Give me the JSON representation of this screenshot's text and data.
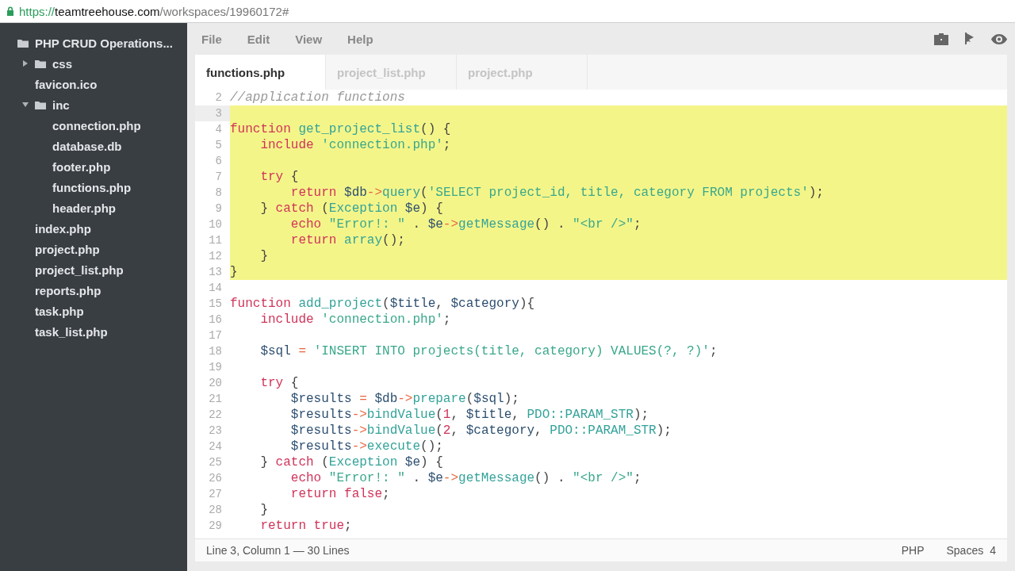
{
  "address_bar": {
    "scheme": "https://",
    "host": "teamtreehouse.com",
    "path": "/workspaces/19960172#"
  },
  "sidebar": {
    "items": [
      {
        "label": "PHP CRUD Operations...",
        "kind": "project",
        "children": [
          {
            "label": "css",
            "kind": "folder",
            "expanded": false
          },
          {
            "label": "favicon.ico",
            "kind": "file"
          },
          {
            "label": "inc",
            "kind": "folder",
            "expanded": true,
            "children": [
              {
                "label": "connection.php",
                "kind": "file"
              },
              {
                "label": "database.db",
                "kind": "file"
              },
              {
                "label": "footer.php",
                "kind": "file"
              },
              {
                "label": "functions.php",
                "kind": "file"
              },
              {
                "label": "header.php",
                "kind": "file"
              }
            ]
          },
          {
            "label": "index.php",
            "kind": "file"
          },
          {
            "label": "project.php",
            "kind": "file"
          },
          {
            "label": "project_list.php",
            "kind": "file"
          },
          {
            "label": "reports.php",
            "kind": "file"
          },
          {
            "label": "task.php",
            "kind": "file"
          },
          {
            "label": "task_list.php",
            "kind": "file"
          }
        ]
      }
    ]
  },
  "menu": [
    "File",
    "Edit",
    "View",
    "Help"
  ],
  "tabs": [
    {
      "label": "functions.php",
      "selected": true
    },
    {
      "label": "project_list.php",
      "selected": false
    },
    {
      "label": "project.php",
      "selected": false
    }
  ],
  "code": [
    {
      "n": "2",
      "highlighted": false,
      "active": false,
      "tokens": [
        {
          "kind": "cmt",
          "text": "//application functions"
        }
      ]
    },
    {
      "n": "3",
      "highlighted": true,
      "active": true
    },
    {
      "n": "4",
      "highlighted": true,
      "active": false,
      "tokens": [
        {
          "kind": "kw",
          "text": "function "
        },
        {
          "kind": "fn",
          "text": "get_project_list"
        },
        {
          "kind": "pl",
          "text": "() {"
        }
      ]
    },
    {
      "n": "5",
      "highlighted": true,
      "active": false,
      "tokens": [
        {
          "kind": "kw",
          "text": "    include "
        },
        {
          "kind": "str",
          "text": "'connection.php'"
        },
        {
          "kind": "pl",
          "text": ";"
        }
      ]
    },
    {
      "n": "6",
      "highlighted": true,
      "active": false
    },
    {
      "n": "7",
      "highlighted": true,
      "active": false,
      "tokens": [
        {
          "kind": "kw",
          "text": "    try"
        },
        {
          "kind": "pl",
          "text": " {"
        }
      ]
    },
    {
      "n": "8",
      "highlighted": true,
      "active": false,
      "tokens": [
        {
          "kind": "kw",
          "text": "        return "
        },
        {
          "kind": "var",
          "text": "$db"
        },
        {
          "kind": "op",
          "text": "->"
        },
        {
          "kind": "fn",
          "text": "query"
        },
        {
          "kind": "pl",
          "text": "("
        },
        {
          "kind": "str",
          "text": "'SELECT project_id, title, category FROM projects'"
        },
        {
          "kind": "pl",
          "text": ");"
        }
      ]
    },
    {
      "n": "9",
      "highlighted": true,
      "active": false,
      "tokens": [
        {
          "kind": "pl",
          "text": "    } "
        },
        {
          "kind": "kw",
          "text": "catch"
        },
        {
          "kind": "pl",
          "text": " ("
        },
        {
          "kind": "cls",
          "text": "Exception"
        },
        {
          "kind": "var",
          "text": " $e"
        },
        {
          "kind": "pl",
          "text": ") {"
        }
      ]
    },
    {
      "n": "10",
      "highlighted": true,
      "active": false,
      "tokens": [
        {
          "kind": "kw",
          "text": "        echo "
        },
        {
          "kind": "str",
          "text": "\"Error!: \""
        },
        {
          "kind": "pl",
          "text": " . "
        },
        {
          "kind": "var",
          "text": "$e"
        },
        {
          "kind": "op",
          "text": "->"
        },
        {
          "kind": "fn",
          "text": "getMessage"
        },
        {
          "kind": "pl",
          "text": "() . "
        },
        {
          "kind": "str",
          "text": "\"<br />\""
        },
        {
          "kind": "pl",
          "text": ";"
        }
      ]
    },
    {
      "n": "11",
      "highlighted": true,
      "active": false,
      "tokens": [
        {
          "kind": "kw",
          "text": "        return "
        },
        {
          "kind": "fn",
          "text": "array"
        },
        {
          "kind": "pl",
          "text": "();"
        }
      ]
    },
    {
      "n": "12",
      "highlighted": true,
      "active": false,
      "tokens": [
        {
          "kind": "pl",
          "text": "    }"
        }
      ]
    },
    {
      "n": "13",
      "highlighted": true,
      "active": false,
      "tokens": [
        {
          "kind": "pl",
          "text": "}"
        }
      ]
    },
    {
      "n": "14",
      "highlighted": false,
      "active": false
    },
    {
      "n": "15",
      "highlighted": false,
      "active": false,
      "tokens": [
        {
          "kind": "kw",
          "text": "function "
        },
        {
          "kind": "fn",
          "text": "add_project"
        },
        {
          "kind": "pl",
          "text": "("
        },
        {
          "kind": "var",
          "text": "$title"
        },
        {
          "kind": "pl",
          "text": ", "
        },
        {
          "kind": "var",
          "text": "$category"
        },
        {
          "kind": "pl",
          "text": "){"
        }
      ]
    },
    {
      "n": "16",
      "highlighted": false,
      "active": false,
      "tokens": [
        {
          "kind": "kw",
          "text": "    include "
        },
        {
          "kind": "str",
          "text": "'connection.php'"
        },
        {
          "kind": "pl",
          "text": ";"
        }
      ]
    },
    {
      "n": "17",
      "highlighted": false,
      "active": false
    },
    {
      "n": "18",
      "highlighted": false,
      "active": false,
      "tokens": [
        {
          "kind": "var",
          "text": "    $sql "
        },
        {
          "kind": "op",
          "text": "= "
        },
        {
          "kind": "str",
          "text": "'INSERT INTO projects(title, category) VALUES(?, ?)'"
        },
        {
          "kind": "pl",
          "text": ";"
        }
      ]
    },
    {
      "n": "19",
      "highlighted": false,
      "active": false
    },
    {
      "n": "20",
      "highlighted": false,
      "active": false,
      "tokens": [
        {
          "kind": "kw",
          "text": "    try"
        },
        {
          "kind": "pl",
          "text": " {"
        }
      ]
    },
    {
      "n": "21",
      "highlighted": false,
      "active": false,
      "tokens": [
        {
          "kind": "var",
          "text": "        $results "
        },
        {
          "kind": "op",
          "text": "= "
        },
        {
          "kind": "var",
          "text": "$db"
        },
        {
          "kind": "op",
          "text": "->"
        },
        {
          "kind": "fn",
          "text": "prepare"
        },
        {
          "kind": "pl",
          "text": "("
        },
        {
          "kind": "var",
          "text": "$sql"
        },
        {
          "kind": "pl",
          "text": ");"
        }
      ]
    },
    {
      "n": "22",
      "highlighted": false,
      "active": false,
      "tokens": [
        {
          "kind": "var",
          "text": "        $results"
        },
        {
          "kind": "op",
          "text": "->"
        },
        {
          "kind": "fn",
          "text": "bindValue"
        },
        {
          "kind": "pl",
          "text": "("
        },
        {
          "kind": "num",
          "text": "1"
        },
        {
          "kind": "pl",
          "text": ", "
        },
        {
          "kind": "var",
          "text": "$title"
        },
        {
          "kind": "pl",
          "text": ", "
        },
        {
          "kind": "cls",
          "text": "PDO::PARAM_STR"
        },
        {
          "kind": "pl",
          "text": ");"
        }
      ]
    },
    {
      "n": "23",
      "highlighted": false,
      "active": false,
      "tokens": [
        {
          "kind": "var",
          "text": "        $results"
        },
        {
          "kind": "op",
          "text": "->"
        },
        {
          "kind": "fn",
          "text": "bindValue"
        },
        {
          "kind": "pl",
          "text": "("
        },
        {
          "kind": "num",
          "text": "2"
        },
        {
          "kind": "pl",
          "text": ", "
        },
        {
          "kind": "var",
          "text": "$category"
        },
        {
          "kind": "pl",
          "text": ", "
        },
        {
          "kind": "cls",
          "text": "PDO::PARAM_STR"
        },
        {
          "kind": "pl",
          "text": ");"
        }
      ]
    },
    {
      "n": "24",
      "highlighted": false,
      "active": false,
      "tokens": [
        {
          "kind": "var",
          "text": "        $results"
        },
        {
          "kind": "op",
          "text": "->"
        },
        {
          "kind": "fn",
          "text": "execute"
        },
        {
          "kind": "pl",
          "text": "();"
        }
      ]
    },
    {
      "n": "25",
      "highlighted": false,
      "active": false,
      "tokens": [
        {
          "kind": "pl",
          "text": "    } "
        },
        {
          "kind": "kw",
          "text": "catch"
        },
        {
          "kind": "pl",
          "text": " ("
        },
        {
          "kind": "cls",
          "text": "Exception"
        },
        {
          "kind": "var",
          "text": " $e"
        },
        {
          "kind": "pl",
          "text": ") {"
        }
      ]
    },
    {
      "n": "26",
      "highlighted": false,
      "active": false,
      "tokens": [
        {
          "kind": "kw",
          "text": "        echo "
        },
        {
          "kind": "str",
          "text": "\"Error!: \""
        },
        {
          "kind": "pl",
          "text": " . "
        },
        {
          "kind": "var",
          "text": "$e"
        },
        {
          "kind": "op",
          "text": "->"
        },
        {
          "kind": "fn",
          "text": "getMessage"
        },
        {
          "kind": "pl",
          "text": "() . "
        },
        {
          "kind": "str",
          "text": "\"<br />\""
        },
        {
          "kind": "pl",
          "text": ";"
        }
      ]
    },
    {
      "n": "27",
      "highlighted": false,
      "active": false,
      "tokens": [
        {
          "kind": "kw",
          "text": "        return false"
        },
        {
          "kind": "pl",
          "text": ";"
        }
      ]
    },
    {
      "n": "28",
      "highlighted": false,
      "active": false,
      "tokens": [
        {
          "kind": "pl",
          "text": "    }"
        }
      ]
    },
    {
      "n": "29",
      "highlighted": false,
      "active": false,
      "tokens": [
        {
          "kind": "kw",
          "text": "    return true"
        },
        {
          "kind": "pl",
          "text": ";"
        }
      ]
    }
  ],
  "status_bar": {
    "position": "Line 3, Column 1 — 30 Lines",
    "language": "PHP",
    "indent_label": "Spaces",
    "indent_size": "4"
  }
}
